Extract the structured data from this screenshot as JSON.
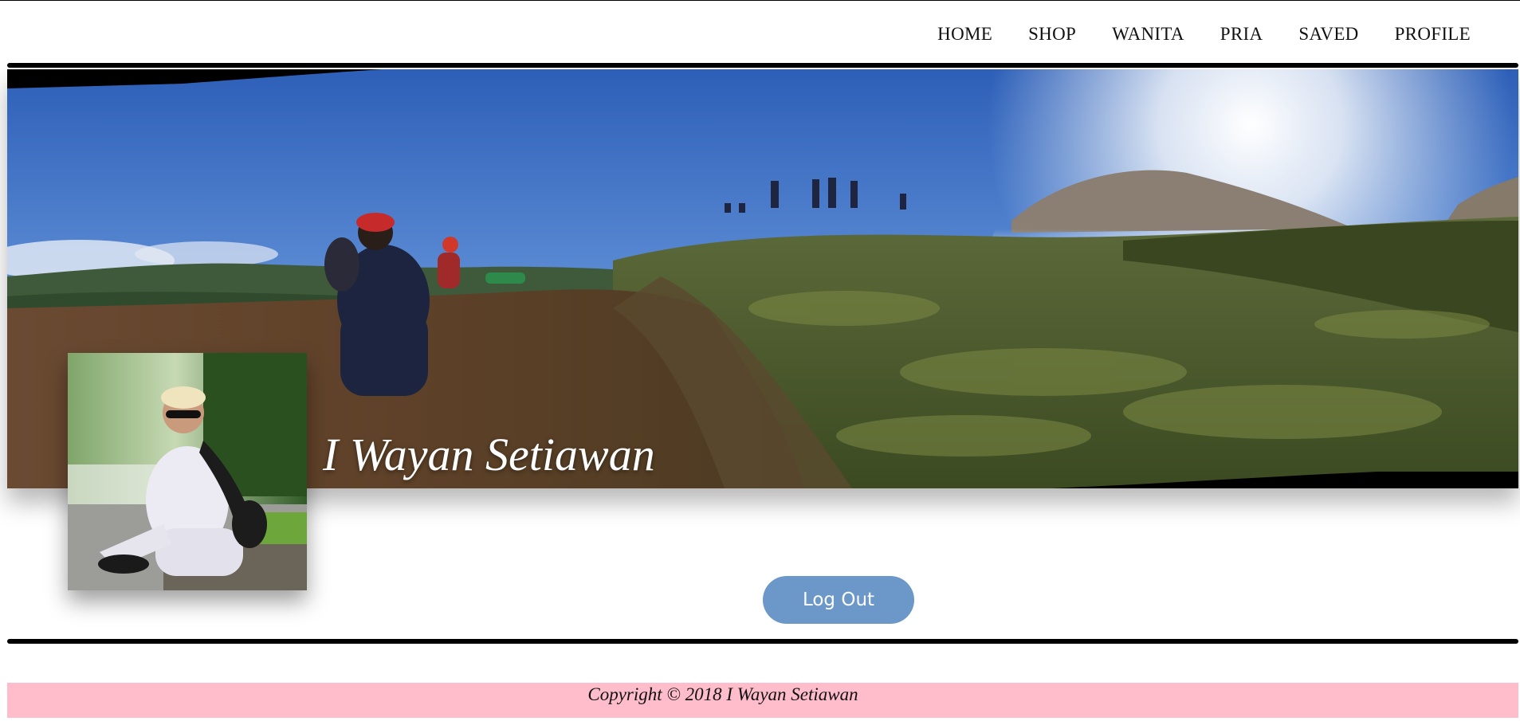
{
  "nav": {
    "items": [
      {
        "label": "HOME"
      },
      {
        "label": "SHOP"
      },
      {
        "label": "WANITA"
      },
      {
        "label": "PRIA"
      },
      {
        "label": "SAVED"
      },
      {
        "label": "PROFILE"
      }
    ]
  },
  "profile": {
    "name": "I Wayan Setiawan",
    "logout_label": "Log Out"
  },
  "footer": {
    "copyright": "Copyright © 2018 I Wayan Setiawan"
  },
  "colors": {
    "logout_button": "#6b98c8",
    "footer_background": "#ffbdcc"
  }
}
